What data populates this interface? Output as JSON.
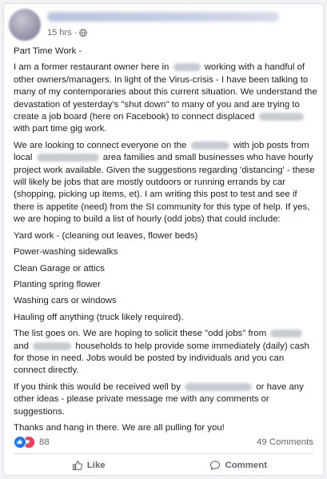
{
  "post": {
    "timestamp": "15 hrs",
    "privacy_icon": "globe-icon",
    "paragraphs": [
      "Part Time Work -",
      "I am a former restaurant owner here in [blurred] working with a handful of other owners/managers. In light of the Virus-crisis - I have been talking to many of my contemporaries about this current situation. We understand the devastation of yesterday's \"shut down\" to many of you and are trying to create a job board (here on Facebook) to connect displaced [blurred] with part time gig work.",
      "We are looking to connect everyone on the [blurred] with job posts from local [blurred] area families and small businesses who have hourly project work available. Given the suggestions regarding 'distancing' - these will likely be jobs that are mostly outdoors or running errands by car (shopping, picking up items, et). I am writing this post to test and see if there is appetite (need) from the SI community for this type of help. If yes, we are hoping to build a list of hourly (odd jobs) that could include:",
      "Yard work - (cleaning out leaves, flower beds)",
      "Power-washing sidewalks",
      "Clean Garage or attics",
      "Planting spring flower",
      "Washing cars or windows",
      "Hauling off anything (truck likely required).",
      "The list goes on. We are hoping to solicit these \"odd jobs\" from [blurred] and [blurred] households to help provide some immediately (daily) cash for those in need. Jobs would be posted by individuals and you can connect directly.",
      "If you think this would be received well by [blurred] or have any other ideas - please private message me with any comments or suggestions.",
      "Thanks and hang in there. We are all pulling for you!"
    ],
    "segments": {
      "title": "Part Time Work -",
      "p1a": "I am a former restaurant owner here in",
      "p1b": "working with a handful of other owners/managers. In light of the Virus-crisis - I have been talking to many of my contemporaries about this current situation. We understand the devastation of yesterday's \"shut down\" to many of you and are trying to create a job board (here on Facebook) to connect displaced",
      "p1c": "with part time gig work.",
      "p2a": "We are looking to connect everyone on the",
      "p2b": "with job posts from local",
      "p2c": "area families and small businesses who have hourly project work available. Given the suggestions regarding 'distancing' - these will likely be jobs that are mostly outdoors or running errands by car (shopping, picking up items, et). I am writing this post to test and see if there is appetite (need) from the SI community for this type of help. If yes, we are hoping to build a list of hourly (odd jobs) that could include:",
      "list": [
        "Yard work - (cleaning out leaves, flower beds)",
        "Power-washing sidewalks",
        "Clean Garage or attics",
        "Planting spring flower",
        "Washing cars or windows",
        "Hauling off anything (truck likely required)."
      ],
      "p3a": "The list goes on. We are hoping to solicit these \"odd jobs\" from",
      "p3b": "and",
      "p3c": "households to help provide some immediately (daily) cash for those in need. Jobs would be posted by individuals and you can connect directly.",
      "p4a": "If you think this would be received well by",
      "p4b": "or have any other ideas - please private message me with any comments or suggestions.",
      "p5": "Thanks and hang in there. We are all pulling for you!"
    }
  },
  "reactions": {
    "icons": [
      "like-reaction-icon",
      "love-reaction-icon"
    ],
    "count": "88",
    "comments": "49 Comments"
  },
  "actions": {
    "like_label": "Like",
    "comment_label": "Comment"
  },
  "colors": {
    "like_blue": "#1877f2",
    "love_red": "#f33e58",
    "secondary_text": "#606770"
  }
}
